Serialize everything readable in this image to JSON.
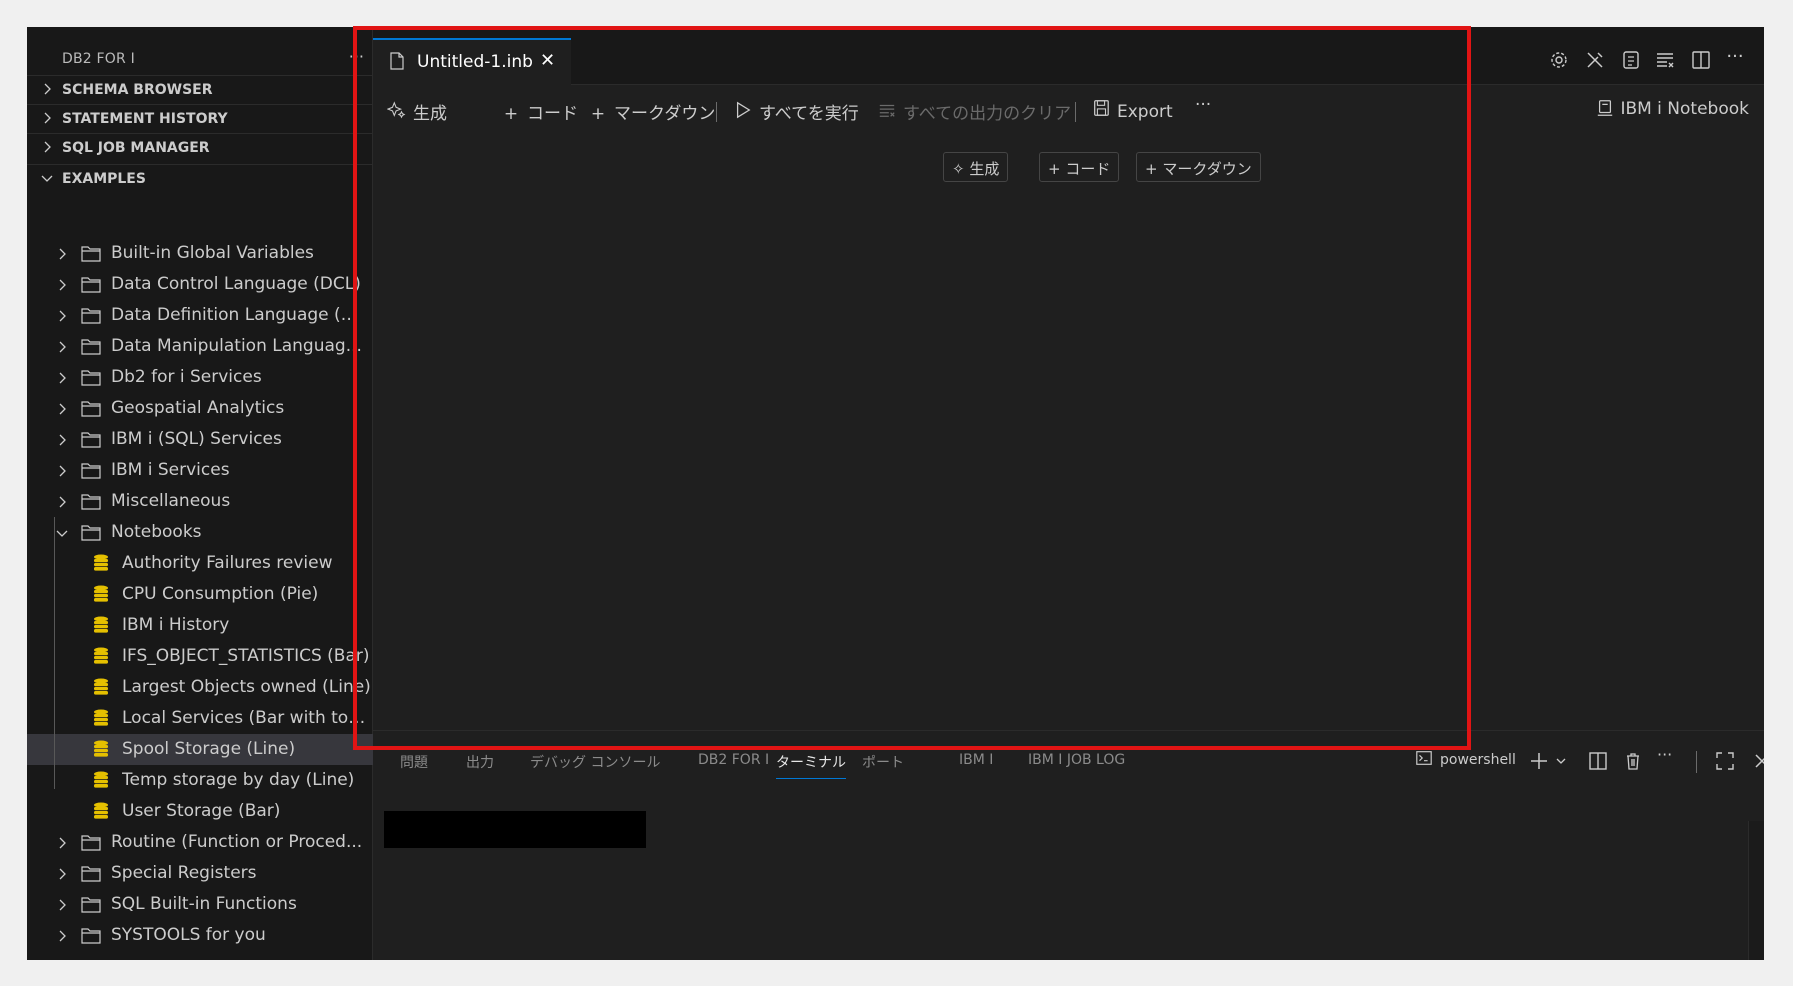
{
  "sidebar": {
    "title": "DB2 FOR I",
    "more": "···",
    "sections": [
      {
        "label": "SCHEMA BROWSER",
        "expanded": false
      },
      {
        "label": "STATEMENT HISTORY",
        "expanded": false
      },
      {
        "label": "SQL JOB MANAGER",
        "expanded": false
      },
      {
        "label": "EXAMPLES",
        "expanded": true
      }
    ],
    "examples": [
      "Built-in Global Variables",
      "Data Control Language (DCL)",
      "Data Definition Language (D...",
      "Data Manipulation Languag...",
      "Db2 for i Services",
      "Geospatial Analytics",
      "IBM i (SQL) Services",
      "IBM i Services",
      "Miscellaneous",
      "Notebooks"
    ],
    "notebooks": [
      "Authority Failures review",
      "CPU Consumption (Pie)",
      "IBM i History",
      "IFS_OBJECT_STATISTICS (Bar)",
      "Largest Objects owned (Line)",
      "Local Services (Bar with too...",
      "Spool Storage (Line)",
      "Temp storage by day (Line)",
      "User Storage (Bar)"
    ],
    "selected_notebook": "Spool Storage (Line)",
    "examples_after": [
      "Routine (Function or Proced...",
      "Special Registers",
      "SQL Built-in Functions",
      "SYSTOOLS for you"
    ]
  },
  "editor": {
    "tab_name": "Untitled-1.inb",
    "tab_close": "✕",
    "toolbar": {
      "generate": "生成",
      "code": "コード",
      "markdown": "マークダウン",
      "run_all": "すべてを実行",
      "clear_outputs": "すべての出力のクリア",
      "export": "Export",
      "more": "···",
      "kernel": "IBM i Notebook"
    },
    "cell_buttons": {
      "generate": "生成",
      "code": "コード",
      "markdown": "マークダウン"
    }
  },
  "panel": {
    "tabs": [
      "問題",
      "出力",
      "デバッグ コンソール",
      "DB2 FOR I",
      "ターミナル",
      "ポート",
      "IBM I",
      "IBM I JOB LOG"
    ],
    "active_tab": "ターミナル",
    "terminal_name": "powershell"
  },
  "colors": {
    "accent": "#0078d4",
    "highlight": "#e11414",
    "database_icon": "#e5c000"
  }
}
